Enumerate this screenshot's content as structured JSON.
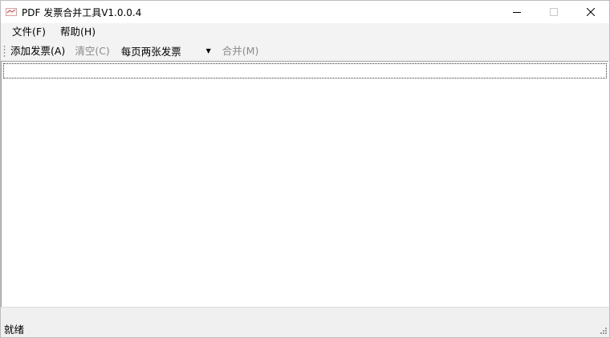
{
  "window": {
    "title": "PDF 发票合并工具V1.0.0.4",
    "minimize_icon": "minimize-icon",
    "maximize_icon": "maximize-icon",
    "close_icon": "close-icon"
  },
  "menubar": {
    "file": "文件(F)",
    "help": "帮助(H)"
  },
  "toolbar": {
    "add_invoice": "添加发票(A)",
    "clear": "清空(C)",
    "layout_select": "每页两张发票",
    "merge": "合并(M)"
  },
  "statusbar": {
    "text": "就绪"
  },
  "colors": {
    "chrome": "#f3f3f3",
    "disabled_text": "#8a8a8a"
  }
}
